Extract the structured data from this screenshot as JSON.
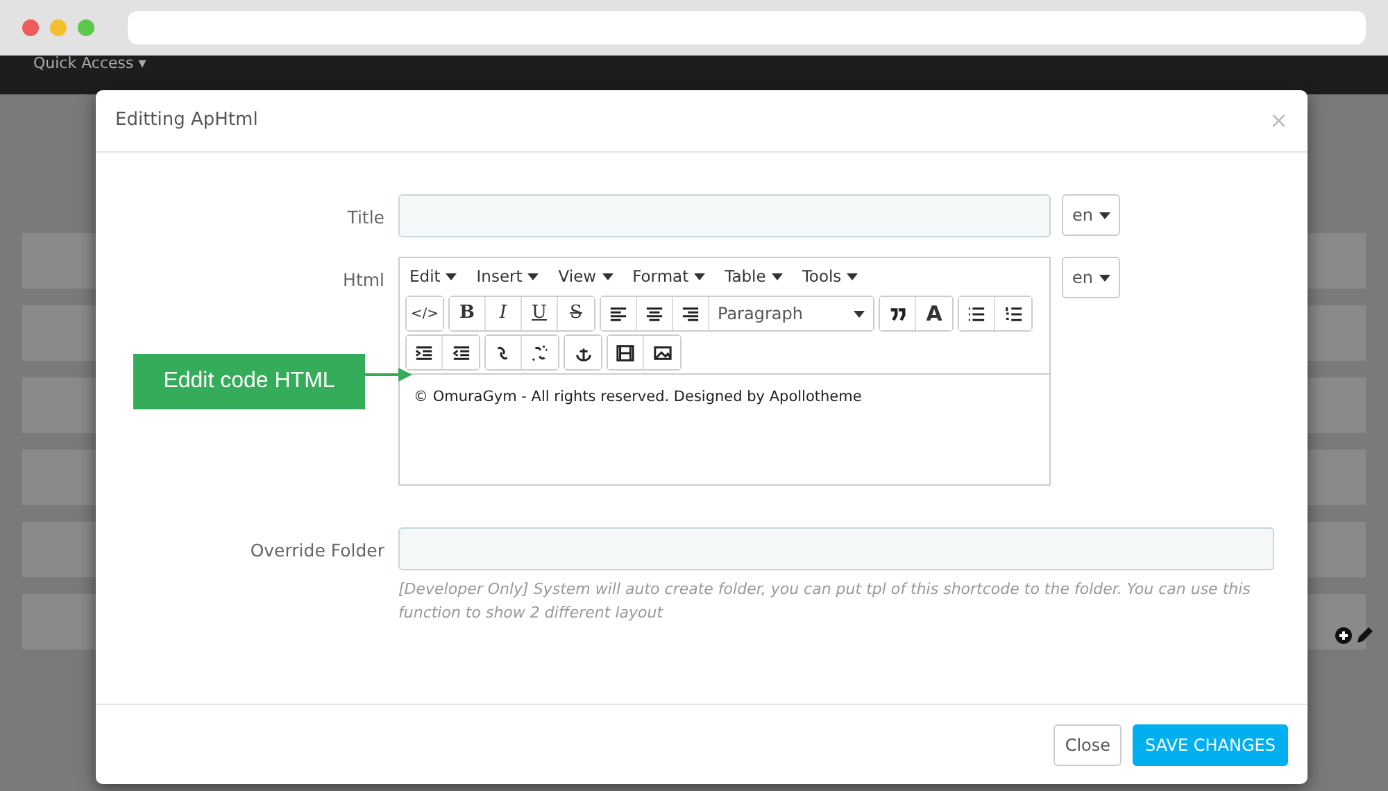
{
  "browser": {
    "dots": [
      {
        "color": "#ee5b5b"
      },
      {
        "color": "#f4be2e"
      },
      {
        "color": "#5cc84a"
      }
    ]
  },
  "admin_bar": {
    "quick_access": "Quick Access ▾"
  },
  "modal": {
    "title": "Editting ApHtml",
    "close": "×",
    "fields": [
      {
        "kind": "text",
        "label": "Title",
        "lang": "en"
      },
      {
        "kind": "editor",
        "label": "Html",
        "lang": "en",
        "menus": [
          "Edit",
          "Insert",
          "View",
          "Format",
          "Table",
          "Tools"
        ],
        "toolbar": [
          [
            [
              {
                "kind": "code",
                "label": "</>"
              }
            ],
            [
              {
                "kind": "bold",
                "label": "B"
              },
              {
                "kind": "italic",
                "label": "I"
              },
              {
                "kind": "underline",
                "label": "U"
              },
              {
                "kind": "strike",
                "label": "S"
              }
            ],
            [
              {
                "kind": "align-left"
              },
              {
                "kind": "align-center"
              },
              {
                "kind": "align-right"
              },
              {
                "kind": "select",
                "label": "Paragraph"
              }
            ],
            [
              {
                "kind": "quote"
              },
              {
                "kind": "color",
                "label": "A"
              }
            ],
            [
              {
                "kind": "bullets"
              },
              {
                "kind": "numbers"
              }
            ]
          ],
          [
            [
              {
                "kind": "indent"
              },
              {
                "kind": "outdent"
              }
            ],
            [
              {
                "kind": "link"
              },
              {
                "kind": "unlink"
              }
            ],
            [
              {
                "kind": "anchor"
              }
            ],
            [
              {
                "kind": "media"
              },
              {
                "kind": "image"
              }
            ]
          ]
        ],
        "content": "© OmuraGym - All rights reserved. Designed by Apollotheme"
      },
      {
        "kind": "wide",
        "label": "Override Folder",
        "help": "[Developer Only] System will auto create folder, you can put tpl of this shortcode to the folder. You can use this function to show 2 different layout"
      }
    ],
    "buttons": [
      {
        "kind": "default",
        "label": "Close"
      },
      {
        "kind": "primary",
        "label": "SAVE CHANGES"
      }
    ]
  },
  "callout": {
    "label": "Eddit code HTML"
  }
}
